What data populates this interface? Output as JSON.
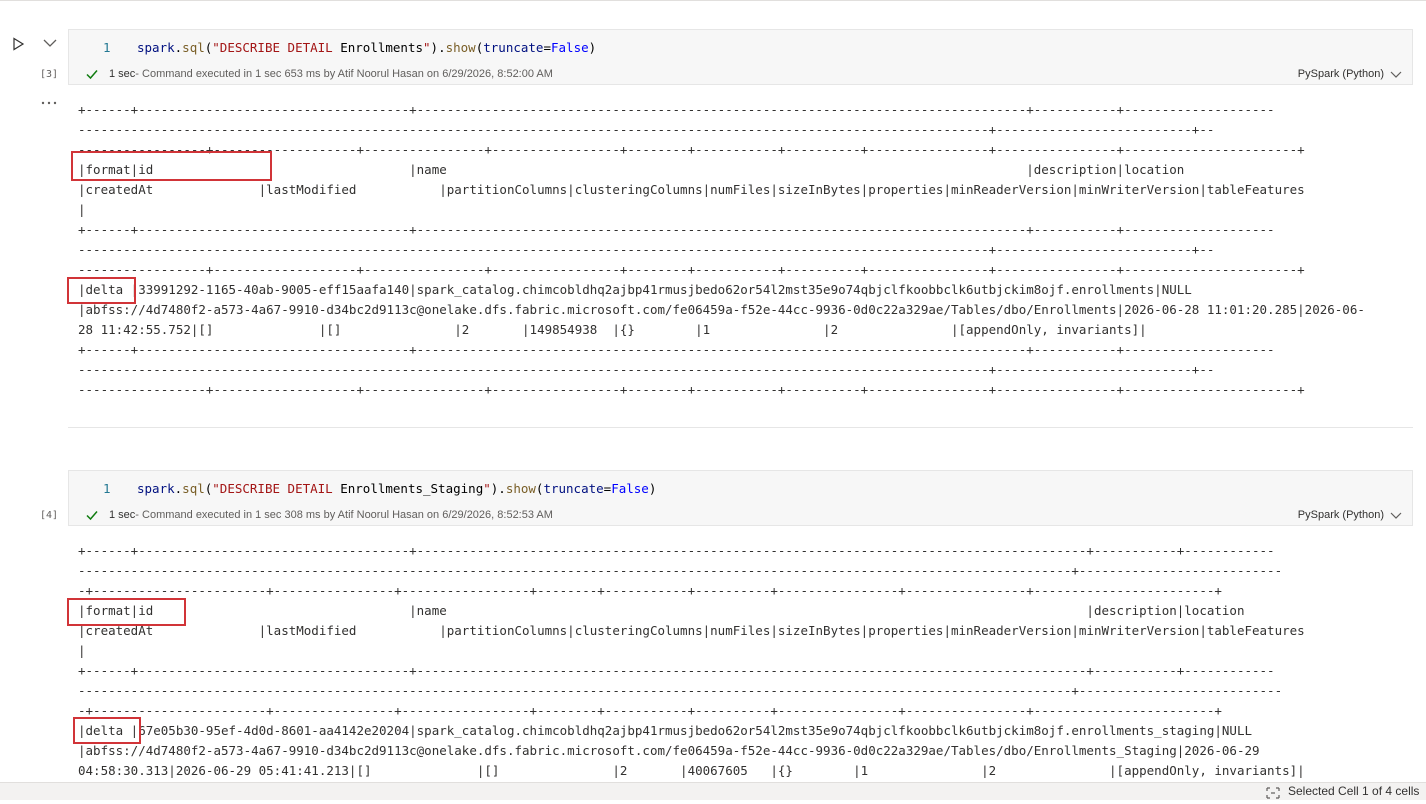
{
  "cells": [
    {
      "exec_count": "[3]",
      "line_number": "1",
      "code_tokens": [
        {
          "t": "spark",
          "c": "tok-var"
        },
        {
          "t": ".",
          "c": "tok-plain"
        },
        {
          "t": "sql",
          "c": "tok-fn"
        },
        {
          "t": "(",
          "c": "tok-plain"
        },
        {
          "t": "\"DESCRIBE DETAIL",
          "c": "tok-str"
        },
        {
          "t": " Enrollments",
          "c": "tok-plain"
        },
        {
          "t": "\"",
          "c": "tok-str"
        },
        {
          "t": ").",
          "c": "tok-plain"
        },
        {
          "t": "show",
          "c": "tok-fn"
        },
        {
          "t": "(",
          "c": "tok-plain"
        },
        {
          "t": "truncate",
          "c": "tok-var"
        },
        {
          "t": "=",
          "c": "tok-plain"
        },
        {
          "t": "False",
          "c": "tok-kw"
        },
        {
          "t": ")",
          "c": "tok-plain"
        }
      ],
      "status_duration": "1 sec",
      "status_text": " - Command executed in 1 sec 653 ms by Atif Noorul Hasan on 6/29/2026, 8:52:00 AM",
      "language": "PySpark (Python)",
      "output_lines": [
        "+------+------------------------------------+---------------------------------------------------------------------------------+-----------+--------------------",
        "-------------------------------------------------------------------------------------------------------------------------+--------------------------+--",
        "-----------------+-------------------+----------------+-----------------+--------+-----------+----------+----------------+----------------+-----------------------+",
        "|format|id                                  |name                                                                             |description|location",
        "|createdAt              |lastModified           |partitionColumns|clusteringColumns|numFiles|sizeInBytes|properties|minReaderVersion|minWriterVersion|tableFeatures",
        "|",
        "+------+------------------------------------+---------------------------------------------------------------------------------+-----------+--------------------",
        "-------------------------------------------------------------------------------------------------------------------------+--------------------------+--",
        "-----------------+-------------------+----------------+-----------------+--------+-----------+----------+----------------+----------------+-----------------------+",
        "|delta |33991292-1165-40ab-9005-eff15aafa140|spark_catalog.chimcobldhq2ajbp41rmusjbedo62or54l2mst35e9o74qbjclfkoobbclk6utbjckim8ojf.enrollments|NULL",
        "|abfss://4d7480f2-a573-4a67-9910-d34bc2d9113c@onelake.dfs.fabric.microsoft.com/fe06459a-f52e-44cc-9936-0d0c22a329ae/Tables/dbo/Enrollments|2026-06-28 11:01:20.285|2026-06-",
        "28 11:42:55.752|[]              |[]               |2       |149854938  |{}        |1               |2               |[appendOnly, invariants]|",
        "+------+------------------------------------+---------------------------------------------------------------------------------+-----------+--------------------",
        "-------------------------------------------------------------------------------------------------------------------------+--------------------------+--",
        "-----------------+-------------------+----------------+-----------------+--------+-----------+----------+----------------+----------------+-----------------------+"
      ]
    },
    {
      "exec_count": "[4]",
      "line_number": "1",
      "code_tokens": [
        {
          "t": "spark",
          "c": "tok-var"
        },
        {
          "t": ".",
          "c": "tok-plain"
        },
        {
          "t": "sql",
          "c": "tok-fn"
        },
        {
          "t": "(",
          "c": "tok-plain"
        },
        {
          "t": "\"DESCRIBE DETAIL",
          "c": "tok-str"
        },
        {
          "t": " Enrollments_Staging",
          "c": "tok-plain"
        },
        {
          "t": "\"",
          "c": "tok-str"
        },
        {
          "t": ").",
          "c": "tok-plain"
        },
        {
          "t": "show",
          "c": "tok-fn"
        },
        {
          "t": "(",
          "c": "tok-plain"
        },
        {
          "t": "truncate",
          "c": "tok-var"
        },
        {
          "t": "=",
          "c": "tok-plain"
        },
        {
          "t": "False",
          "c": "tok-kw"
        },
        {
          "t": ")",
          "c": "tok-plain"
        }
      ],
      "status_duration": "1 sec",
      "status_text": " - Command executed in 1 sec 308 ms by Atif Noorul Hasan on 6/29/2026, 8:52:53 AM",
      "language": "PySpark (Python)",
      "output_lines": [
        "+------+------------------------------------+-----------------------------------------------------------------------------------------+-----------+------------",
        "------------------------------------------------------------------------------------------------------------------------------------+---------------------------",
        "-+-----------------------+----------------+-----------------+--------+-----------+----------+----------------+----------------+------------------------+",
        "|format|id                                  |name                                                                                     |description|location",
        "|createdAt              |lastModified           |partitionColumns|clusteringColumns|numFiles|sizeInBytes|properties|minReaderVersion|minWriterVersion|tableFeatures",
        "|",
        "+------+------------------------------------+-----------------------------------------------------------------------------------------+-----------+------------",
        "------------------------------------------------------------------------------------------------------------------------------------+---------------------------",
        "-+-----------------------+----------------+-----------------+--------+-----------+----------+----------------+----------------+------------------------+",
        "|delta |67e05b30-95ef-4d0d-8601-aa4142e20204|spark_catalog.chimcobldhq2ajbp41rmusjbedo62or54l2mst35e9o74qbjclfkoobbclk6utbjckim8ojf.enrollments_staging|NULL",
        "|abfss://4d7480f2-a573-4a67-9910-d34bc2d9113c@onelake.dfs.fabric.microsoft.com/fe06459a-f52e-44cc-9936-0d0c22a329ae/Tables/dbo/Enrollments_Staging|2026-06-29",
        "04:58:30.313|2026-06-29 05:41:41.213|[]              |[]               |2       |40067605   |{}        |1               |2               |[appendOnly, invariants]|"
      ]
    }
  ],
  "status_bar": {
    "selection_text": "Selected Cell 1 of 4 cells"
  },
  "colors": {
    "highlight_box": "#d13438",
    "success_check": "#107c10"
  }
}
